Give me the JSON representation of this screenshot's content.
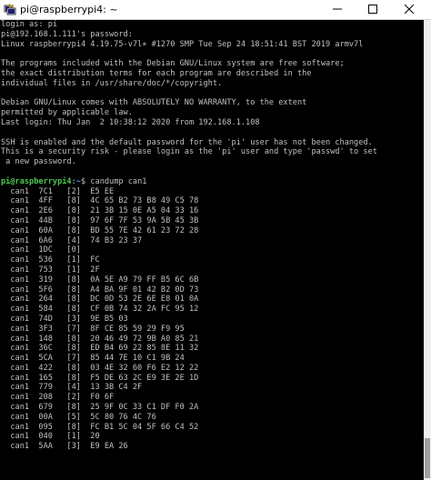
{
  "window": {
    "title": "pi@raspberrypi4: ~",
    "icon": "putty-terminal-icon",
    "controls": [
      "minimize-icon",
      "maximize-icon",
      "close-icon"
    ]
  },
  "terminal": {
    "lines": [
      "login as: pi",
      "pi@192.168.1.111's password:",
      "Linux raspberrypi4 4.19.75-v7l+ #1270 SMP Tue Sep 24 18:51:41 BST 2019 armv7l",
      "",
      "The programs included with the Debian GNU/Linux system are free software;",
      "the exact distribution terms for each program are described in the",
      "individual files in /usr/share/doc/*/copyright.",
      "",
      "Debian GNU/Linux comes with ABSOLUTELY NO WARRANTY, to the extent",
      "permitted by applicable law.",
      "Last login: Thu Jan  2 10:38:12 2020 from 192.168.1.108",
      "",
      "SSH is enabled and the default password for the 'pi' user has not been changed.",
      "This is a security risk - please login as the 'pi' user and type 'passwd' to set",
      " a new password.",
      ""
    ],
    "prompt": {
      "user_host": "pi@raspberrypi4",
      "path": "~",
      "symbol": "$",
      "command": "candump can1"
    },
    "frames": [
      "  can1  7C1   [2]  E5 EE",
      "  can1  4FF   [8]  4C 65 B2 73 B8 49 C5 78",
      "  can1  2E6   [8]  21 3B 15 0E A5 04 33 16",
      "  can1  44B   [8]  97 6F 7F 53 9A 5B 45 3B",
      "  can1  60A   [8]  BD 55 7E 42 61 23 72 28",
      "  can1  6A6   [4]  74 B3 23 37",
      "  can1  1DC   [0]",
      "  can1  536   [1]  FC",
      "  can1  753   [1]  2F",
      "  can1  319   [8]  0A 5E A9 79 FF B5 6C 6B",
      "  can1  5F6   [8]  A4 BA 9F 01 42 B2 0D 73",
      "  can1  264   [8]  DC 0D 53 2E 6E E8 01 0A",
      "  can1  584   [8]  CF 0B 74 32 2A FC 95 12",
      "  can1  74D   [3]  9E B5 03",
      "  can1  3F3   [7]  8F CE 85 59 29 F9 95",
      "  can1  148   [8]  20 46 49 72 9B A0 85 21",
      "  can1  36C   [8]  ED B4 69 22 85 8E 11 32",
      "  can1  5CA   [7]  85 44 7E 10 C1 9B 24",
      "  can1  422   [8]  03 4E 32 60 F6 E2 12 22",
      "  can1  165   [8]  F5 DE 63 2C E9 3E 2E 1D",
      "  can1  779   [4]  13 3B C4 2F",
      "  can1  208   [2]  F0 6F",
      "  can1  679   [8]  25 9F 0C 33 C1 DF F0 2A",
      "  can1  00A   [5]  5C 80 76 4C 76",
      "  can1  095   [8]  FC B1 5C 04 5F 66 C4 52",
      "  can1  040   [1]  20",
      "  can1  5AA   [3]  E9 EA 26"
    ]
  },
  "scrollbar": {
    "position_fraction": 0.92
  },
  "colors": {
    "background": "#000000",
    "text": "#c0c0c0",
    "prompt_user": "#4ec94e",
    "prompt_path": "#5b8cff"
  }
}
